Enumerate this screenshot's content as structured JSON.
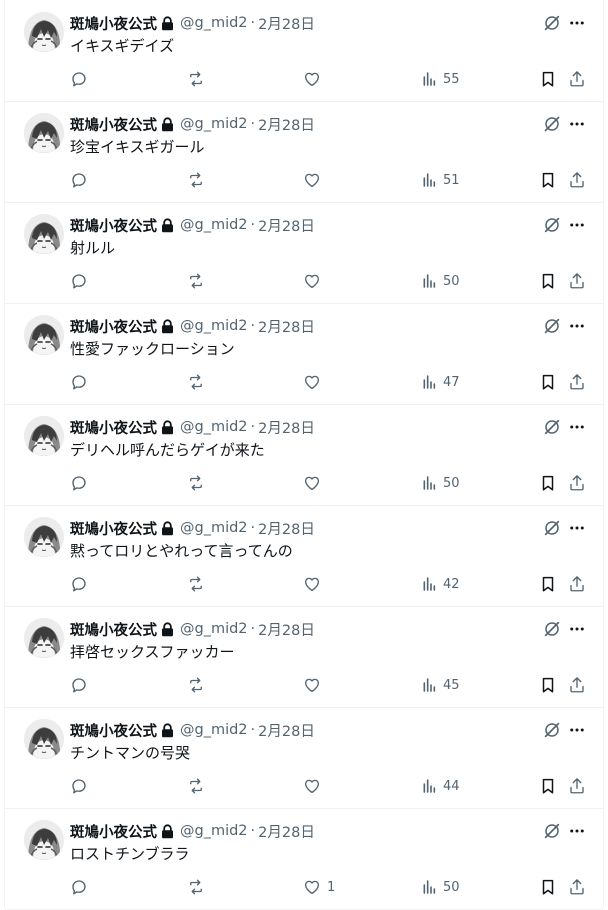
{
  "author": {
    "name": "斑鳩小夜公式",
    "handle": "@g_mid2",
    "separator": "·",
    "locked": true
  },
  "colors": {
    "text": "#0f1419",
    "secondary": "#536471",
    "border": "#eff3f4"
  },
  "icons": {
    "reply": "reply-icon",
    "retweet": "retweet-icon",
    "like": "heart-icon",
    "views": "views-chart-icon",
    "bookmark": "bookmark-icon",
    "share": "share-icon",
    "grok": "grok-icon",
    "more": "more-icon",
    "lock": "lock-icon"
  },
  "tweets": [
    {
      "date": "2月28日",
      "text": "イキスギデイズ",
      "likes": "",
      "views": "55"
    },
    {
      "date": "2月28日",
      "text": "珍宝イキスギガール",
      "likes": "",
      "views": "51"
    },
    {
      "date": "2月28日",
      "text": "射ルル",
      "likes": "",
      "views": "50"
    },
    {
      "date": "2月28日",
      "text": "性愛ファックローション",
      "likes": "",
      "views": "47"
    },
    {
      "date": "2月28日",
      "text": "デリヘル呼んだらゲイが来た",
      "likes": "",
      "views": "50"
    },
    {
      "date": "2月28日",
      "text": "黙ってロリとやれって言ってんの",
      "likes": "",
      "views": "42"
    },
    {
      "date": "2月28日",
      "text": "拝啓セックスファッカー",
      "likes": "",
      "views": "45"
    },
    {
      "date": "2月28日",
      "text": "チントマンの号哭",
      "likes": "",
      "views": "44"
    },
    {
      "date": "2月28日",
      "text": "ロストチンブララ",
      "likes": "1",
      "views": "50"
    }
  ]
}
